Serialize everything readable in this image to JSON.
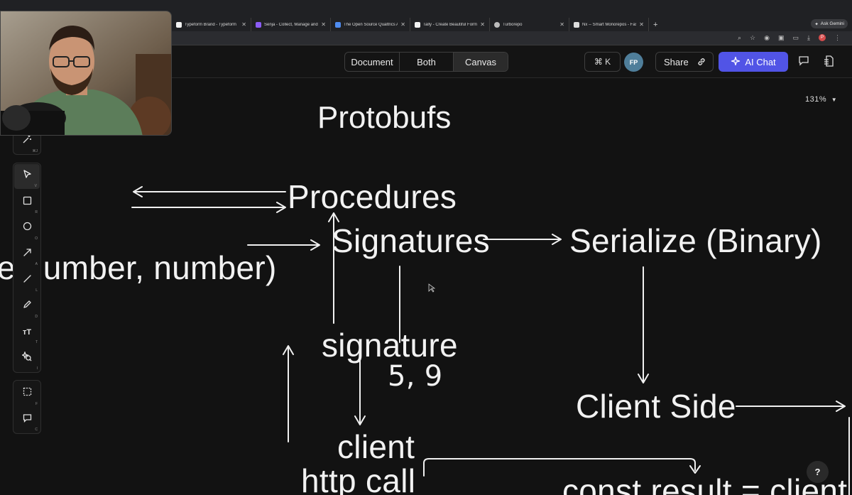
{
  "browser": {
    "tabs": [
      {
        "title": "Typeform Brand - Typeform",
        "favicon_color": "#f2f2f2"
      },
      {
        "title": "Senja - Collect, Manage and...",
        "favicon_color": "#8b5cf6"
      },
      {
        "title": "The Open Source Qualtrics A...",
        "favicon_color": "#4f8cf0"
      },
      {
        "title": "Tally - Create Beautiful Forms",
        "favicon_color": "#f2f2f2"
      },
      {
        "title": "Turborepo",
        "favicon_color": "#bbbbbb"
      },
      {
        "title": "Nx -- Smart Monorepos - Fast...",
        "favicon_color": "#dddddd"
      }
    ],
    "ask_gemini": "Ask Gemini",
    "profile_initial": "P"
  },
  "header": {
    "view_modes": {
      "document": "Document",
      "both": "Both",
      "canvas": "Canvas"
    },
    "active_mode": "Canvas",
    "command_shortcut": "⌘ K",
    "avatar_initials": "FP",
    "share_label": "Share",
    "ai_chat_label": "AI Chat",
    "accent_color": "#5154e6"
  },
  "canvas": {
    "zoom": "131%",
    "texts": {
      "title": "Protobufs",
      "procedures": "Procedures",
      "signatures": "Signatures",
      "serialize": "Serialize (Binary)",
      "number_args": "pe number, number)",
      "signature": "signature",
      "signature_nums": "5, 9",
      "client_side": "Client Side",
      "client": "client",
      "http_call": "http call",
      "const_result": "const result = client"
    }
  },
  "toolbar": {
    "top_tool": {
      "icon": "magic-wand-icon",
      "shortcut": "⌘J"
    },
    "tools": [
      {
        "name": "select",
        "icon": "pointer-icon",
        "shortcut": "V"
      },
      {
        "name": "rectangle",
        "icon": "rectangle-icon",
        "shortcut": "R"
      },
      {
        "name": "ellipse",
        "icon": "circle-icon",
        "shortcut": "O"
      },
      {
        "name": "arrow",
        "icon": "arrow-icon",
        "shortcut": "A"
      },
      {
        "name": "line",
        "icon": "line-icon",
        "shortcut": "L"
      },
      {
        "name": "draw",
        "icon": "pencil-icon",
        "shortcut": "D"
      },
      {
        "name": "text",
        "icon": "text-icon",
        "shortcut": "T"
      },
      {
        "name": "image",
        "icon": "image-search-icon",
        "shortcut": "I"
      }
    ],
    "bottom_tools": [
      {
        "name": "frame",
        "icon": "frame-icon",
        "shortcut": "F"
      },
      {
        "name": "comment",
        "icon": "comment-icon",
        "shortcut": "C"
      }
    ]
  },
  "help_label": "?"
}
